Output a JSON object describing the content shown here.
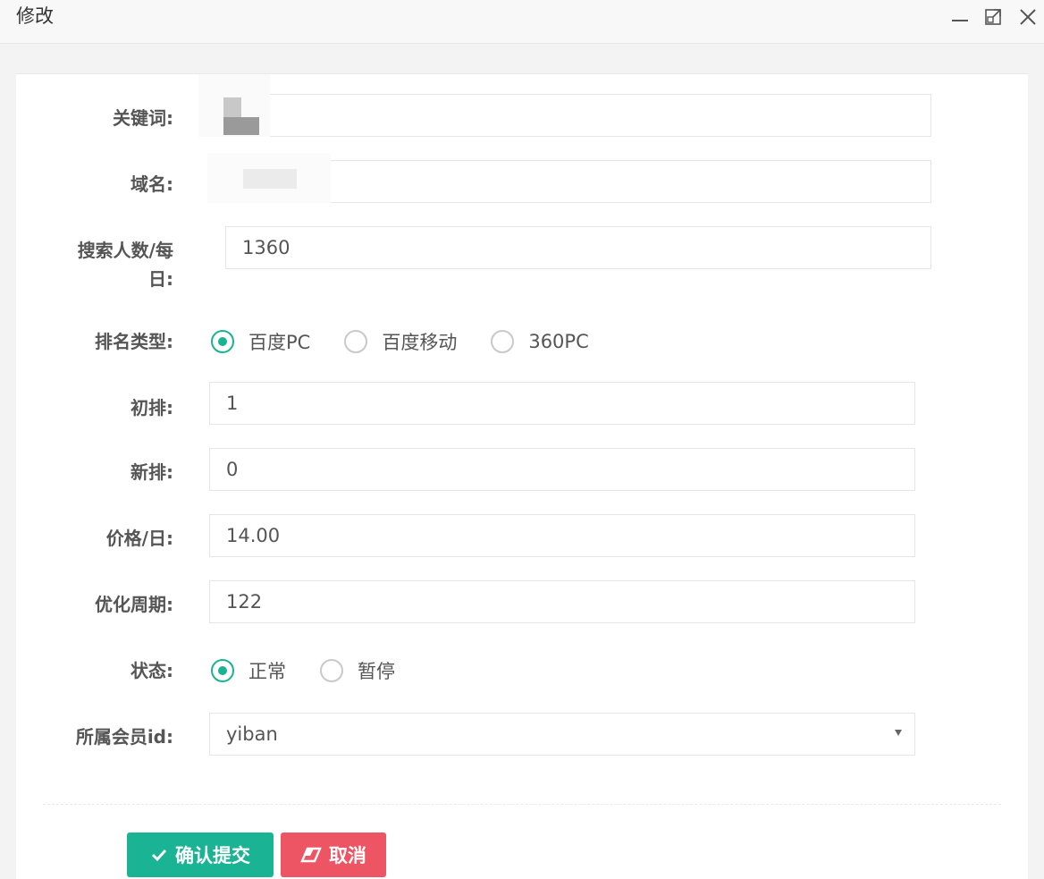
{
  "dialog": {
    "title": "修改"
  },
  "window_controls": [
    "minimize-icon",
    "maximize-icon",
    "close-icon"
  ],
  "form": {
    "keyword": {
      "label": "关键词:",
      "value": ""
    },
    "domain": {
      "label": "域名:",
      "value": ""
    },
    "search_count": {
      "label": "搜索人数/每日:",
      "label_line1": "搜索人数/每",
      "label_line2": "日:",
      "value": "1360"
    },
    "rank_type": {
      "label": "排名类型:",
      "options": [
        "百度PC",
        "百度移动",
        "360PC"
      ],
      "selected": "百度PC"
    },
    "initial_rank": {
      "label": "初排:",
      "value": "1"
    },
    "new_rank": {
      "label": "新排:",
      "value": "0"
    },
    "price_per_day": {
      "label": "价格/日:",
      "value": "14.00"
    },
    "optimize_period": {
      "label": "优化周期:",
      "value": "122"
    },
    "status": {
      "label": "状态:",
      "options": [
        "正常",
        "暂停"
      ],
      "selected": "正常"
    },
    "member_id": {
      "label": "所属会员id:",
      "value": "yiban"
    }
  },
  "buttons": {
    "submit": "确认提交",
    "cancel": "取消"
  },
  "colors": {
    "primary": "#1ab394",
    "danger": "#ed5565"
  }
}
